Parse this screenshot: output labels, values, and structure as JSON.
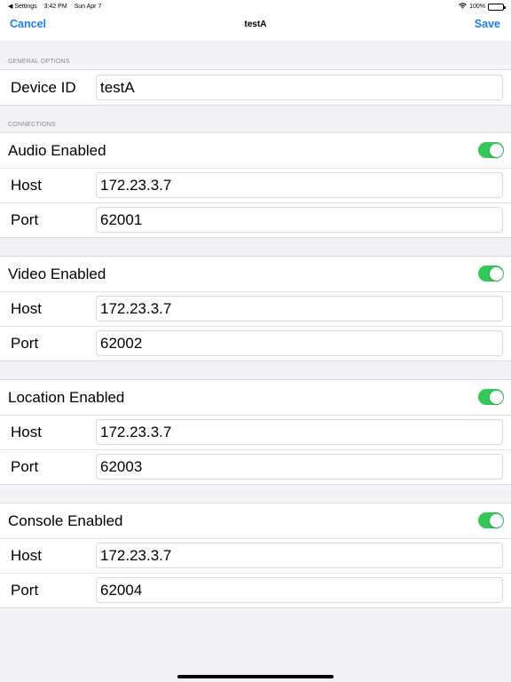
{
  "status_bar": {
    "back_app": "◀ Settings",
    "time": "3:42 PM",
    "date": "Sun Apr 7",
    "battery": "100%",
    "battery_level": 1.0,
    "wifi_icon": "wifi-icon"
  },
  "nav": {
    "cancel": "Cancel",
    "title": "testA",
    "save": "Save",
    "accent_color": "#1a7ff5"
  },
  "general": {
    "header": "GENERAL OPTIONS",
    "device_id_label": "Device ID",
    "device_id_value": "testA"
  },
  "connections": {
    "header": "CONNECTIONS",
    "toggle_on_color": "#34c759",
    "groups": [
      {
        "toggle_label": "Audio Enabled",
        "enabled": true,
        "host_label": "Host",
        "host_value": "172.23.3.7",
        "port_label": "Port",
        "port_value": "62001"
      },
      {
        "toggle_label": "Video Enabled",
        "enabled": true,
        "host_label": "Host",
        "host_value": "172.23.3.7",
        "port_label": "Port",
        "port_value": "62002"
      },
      {
        "toggle_label": "Location Enabled",
        "enabled": true,
        "host_label": "Host",
        "host_value": "172.23.3.7",
        "port_label": "Port",
        "port_value": "62003"
      },
      {
        "toggle_label": "Console Enabled",
        "enabled": true,
        "host_label": "Host",
        "host_value": "172.23.3.7",
        "port_label": "Port",
        "port_value": "62004"
      }
    ]
  }
}
